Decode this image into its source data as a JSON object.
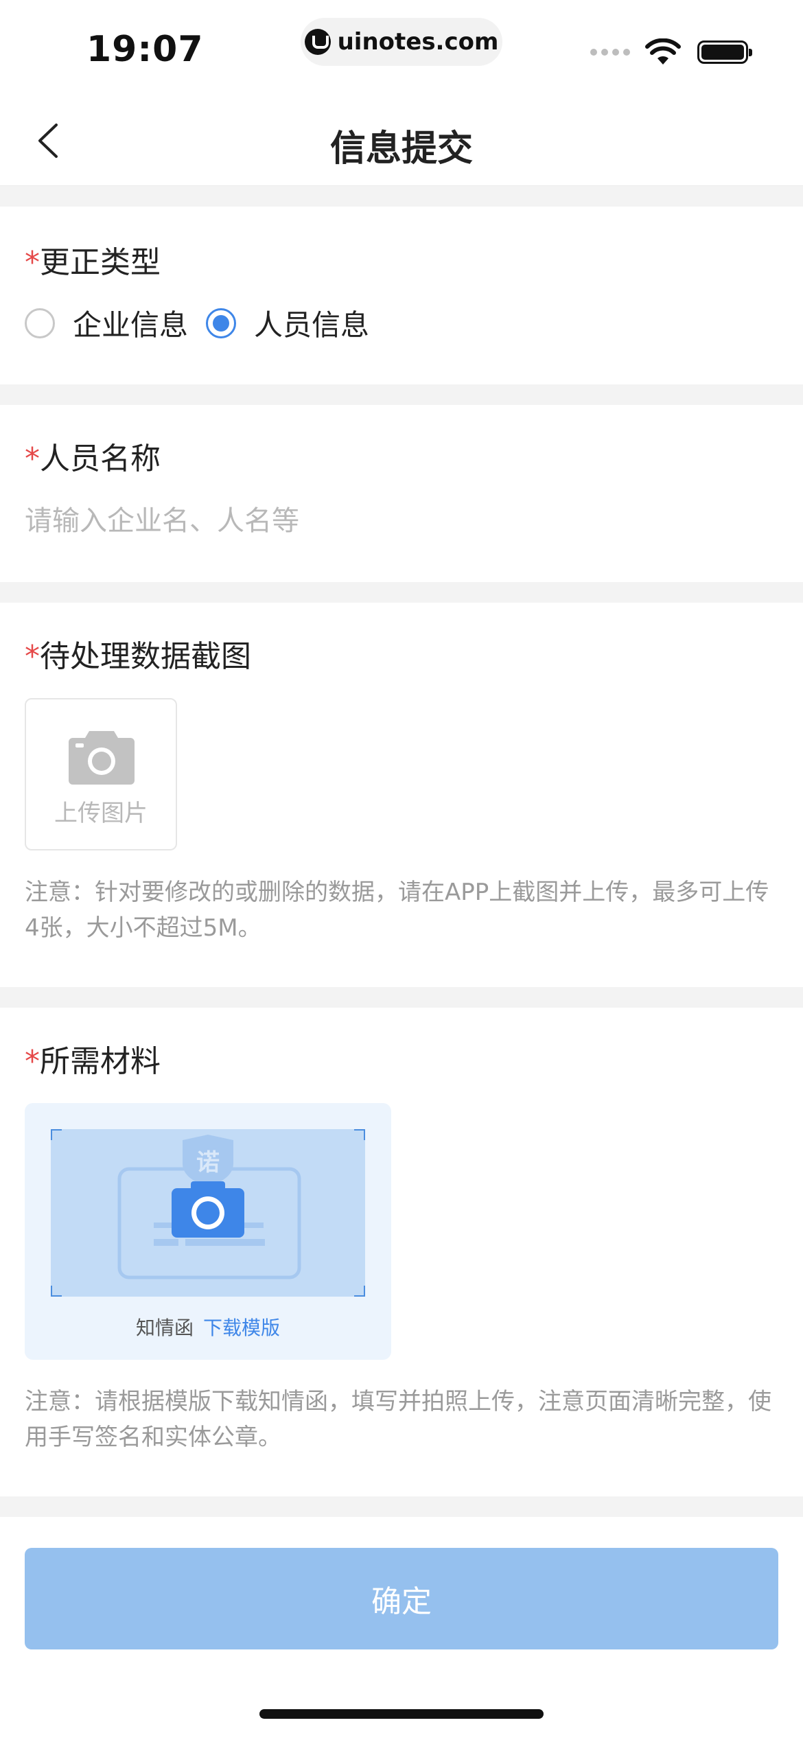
{
  "status_bar": {
    "time": "19:07",
    "url": "uinotes.com"
  },
  "nav": {
    "title": "信息提交"
  },
  "correction_type": {
    "required_mark": "*",
    "label": "更正类型",
    "options": [
      {
        "label": "企业信息",
        "checked": false
      },
      {
        "label": "人员信息",
        "checked": true
      }
    ]
  },
  "person_name": {
    "required_mark": "*",
    "label": "人员名称",
    "value": "",
    "placeholder": "请输入企业名、人名等"
  },
  "screenshot": {
    "required_mark": "*",
    "label": "待处理数据截图",
    "upload_label": "上传图片",
    "note": "注意：针对要修改的或删除的数据，请在APP上截图并上传，最多可上传4张，大小不超过5M。"
  },
  "materials": {
    "required_mark": "*",
    "label": "所需材料",
    "template_badge": "诺",
    "template_name": "知情函",
    "download_link": "下载模版",
    "note": "注意：请根据模版下载知情函，填写并拍照上传，注意页面清晰完整，使用手写签名和实体公章。"
  },
  "confirm_button": "确定",
  "colors": {
    "accent": "#3e86e8",
    "required": "#e54848",
    "button_disabled": "#95c0ee",
    "section_gap": "#f3f3f3"
  }
}
